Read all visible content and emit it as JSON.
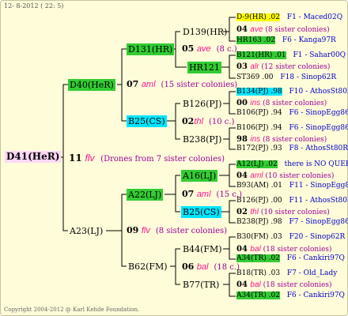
{
  "header": {
    "date": "12-  8-2012 ( 22:  5)"
  },
  "footer": {
    "copyright": "Copyright 2004-2012 @ Karl Kehde Foundation."
  },
  "root": {
    "label": "D41(HeR)",
    "number": "11",
    "code": "flv",
    "note": "(Drones from 7 sister colonies)"
  },
  "mother": {
    "label": "D40(HeR)",
    "number": "07",
    "code": "aml",
    "note": "(15 sister colonies)"
  },
  "mother_father": {
    "label": "A23(LJ)",
    "number": "09",
    "code": "flv",
    "note": "(8 sister colonies)"
  },
  "gen3": {
    "a": {
      "label": "D131(HR)",
      "number": "05",
      "code": "ave",
      "note": "(8 c.)"
    },
    "b": {
      "label": "B25(CS)",
      "number": "02",
      "code": "thl",
      "note": "(10 c.)"
    },
    "c": {
      "label": "A22(LJ)",
      "number": "07",
      "code": "aml",
      "note": "(15 c.)"
    },
    "d": {
      "label": "B62(FM)",
      "number": "06",
      "code": "bal",
      "note": "(18 c.)"
    }
  },
  "gen4": {
    "a1": {
      "label": "D139(HR)"
    },
    "a2": {
      "label": "HR121",
      "number": "03",
      "code": "alr",
      "note": "(12 sister colonies)"
    },
    "b1": {
      "label": "B126(PJ)",
      "number": "00",
      "code": "ins",
      "note": "(8 sister colonies)"
    },
    "b2": {
      "label": "B238(PJ)",
      "number": "98",
      "code": "ins",
      "note": "(8 sister colonies)"
    },
    "c1": {
      "label": "A16(LJ)",
      "number": "04",
      "code": "aml",
      "note": "(10 sister colonies)"
    },
    "c2": {
      "label": "B25(CS)",
      "number": "02",
      "code": "thl",
      "note": "(10 sister colonies)"
    },
    "d1": {
      "label": "B44(FM)",
      "number": "04",
      "code": "bal",
      "note": "(18 sister colonies)"
    },
    "d2": {
      "label": "B77(TR)",
      "number": "04",
      "code": "bal",
      "note": "(18 sister colonies)"
    }
  },
  "a1_top": {
    "number": "04",
    "code": "ave",
    "note": "(8 sister colonies)"
  },
  "leaves": [
    {
      "id": "D-9(HR)",
      "year": ".02",
      "ref": "F1 - Maced02Q",
      "style": "y"
    },
    {
      "id": "HR163",
      "year": ".02",
      "ref": "F6 - Kanga97R",
      "style": "g"
    },
    {
      "id": "B121(HR)",
      "year": ".01",
      "ref": "F1 - Sahar00Q",
      "style": "g"
    },
    {
      "id": "ST369",
      "year": ".00",
      "ref": "F18 - Sinop62R",
      "style": ""
    },
    {
      "id": "B134(PJ)",
      "year": ".98",
      "ref": "F10 - AthosSt80R",
      "style": "c"
    },
    {
      "id": "B106(PJ)",
      "year": ".94",
      "ref": "F6 - SinopEgg86R",
      "style": ""
    },
    {
      "id": "B106(PJ)",
      "year": ".94",
      "ref": "F6 - SinopEgg86R",
      "style": ""
    },
    {
      "id": "B172(PJ)",
      "year": ".93",
      "ref": "F8 - AthosSt80R",
      "style": ""
    },
    {
      "id": "A12(LJ)",
      "year": ".02",
      "ref": "there is NO QUEEN",
      "style": "g"
    },
    {
      "id": "B93(AM)",
      "year": ".01",
      "ref": "F11 - SinopEgg86R",
      "style": ""
    },
    {
      "id": "B126(PJ)",
      "year": ".00",
      "ref": "F11 - AthosSt80R",
      "style": ""
    },
    {
      "id": "B238(PJ)",
      "year": ".98",
      "ref": "F7 - SinopEgg86R",
      "style": ""
    },
    {
      "id": "B30(FM)",
      "year": ".03",
      "ref": "F20 - Sinop62R",
      "style": ""
    },
    {
      "id": "A34(TR)",
      "year": ".02",
      "ref": "F6 - Cankiri97Q",
      "style": "g"
    },
    {
      "id": "B18(TR)",
      "year": ".03",
      "ref": "F7 - Old_Lady",
      "style": ""
    },
    {
      "id": "A34(TR)",
      "year": ".02",
      "ref": "F6 - Cankiri97Q",
      "style": "g"
    }
  ],
  "leaf_notes": [
    {
      "number": "04",
      "code": "ave",
      "note": "(8 sister colonies)"
    },
    {
      "number": "03",
      "code": "alr",
      "note": "(12 sister colonies)"
    },
    {
      "number": "00",
      "code": "ins",
      "note": "(8 sister colonies)"
    },
    {
      "number": "98",
      "code": "ins",
      "note": "(8 sister colonies)"
    },
    {
      "number": "04",
      "code": "aml",
      "note": "(10 sister colonies)"
    },
    {
      "number": "02",
      "code": "thl",
      "note": "(10 sister colonies)"
    },
    {
      "number": "04",
      "code": "bal",
      "note": "(18 sister colonies)"
    },
    {
      "number": "04",
      "code": "bal",
      "note": "(18 sister colonies)"
    }
  ]
}
